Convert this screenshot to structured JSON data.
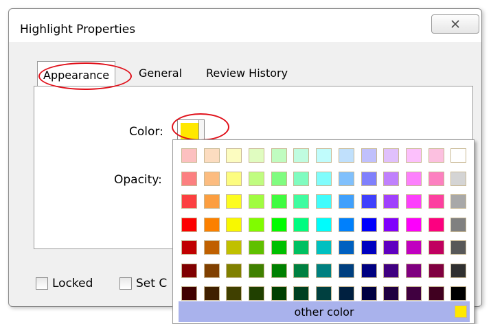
{
  "dialog": {
    "title": "Highlight Properties"
  },
  "tabs": [
    {
      "label": "Appearance"
    },
    {
      "label": "General"
    },
    {
      "label": "Review History"
    }
  ],
  "appearance": {
    "color_label": "Color:",
    "opacity_label": "Opacity:",
    "selected_color": "#ffe800"
  },
  "checkboxes": {
    "locked": "Locked",
    "set_current": "Set C"
  },
  "palette": {
    "other_color_label": "other color",
    "other_color_swatch": "#ffe800",
    "rows": [
      [
        "#fcc0c0",
        "#fcdcc0",
        "#fcfcc0",
        "#e0fcc0",
        "#c0fcc0",
        "#c0fce0",
        "#c0fcfc",
        "#c0e0fc",
        "#c0c0fc",
        "#e0c0fc",
        "#fcc0fc",
        "#fcc0e0",
        "#ffffff"
      ],
      [
        "#fc8080",
        "#fcbc80",
        "#fcfc80",
        "#c0fc80",
        "#80fc80",
        "#80fcc0",
        "#80fcfc",
        "#80c0fc",
        "#8080fc",
        "#c080fc",
        "#fc80fc",
        "#fc80c0",
        "#d4d4d4"
      ],
      [
        "#fc4040",
        "#fc9e40",
        "#fcfc20",
        "#a0fc40",
        "#40fc40",
        "#40fca0",
        "#40fcfc",
        "#40a0fc",
        "#4040fc",
        "#a040fc",
        "#fc40fc",
        "#fc40a0",
        "#a8a8a8"
      ],
      [
        "#fc0000",
        "#fc8000",
        "#f8f800",
        "#80fc00",
        "#00fc00",
        "#00fc80",
        "#00fcfc",
        "#0080fc",
        "#0000fc",
        "#8000fc",
        "#fc00fc",
        "#fc0080",
        "#808080"
      ],
      [
        "#c00000",
        "#c06000",
        "#c0c000",
        "#60c000",
        "#00c000",
        "#00c060",
        "#00c0c0",
        "#0060c0",
        "#0000c0",
        "#6000c0",
        "#c000c0",
        "#c00060",
        "#585858"
      ],
      [
        "#800000",
        "#804000",
        "#808000",
        "#408000",
        "#008000",
        "#008040",
        "#008080",
        "#004080",
        "#000080",
        "#400080",
        "#800080",
        "#800040",
        "#303030"
      ],
      [
        "#400000",
        "#402000",
        "#404000",
        "#204000",
        "#004000",
        "#004020",
        "#004040",
        "#002040",
        "#000040",
        "#200040",
        "#400040",
        "#400020",
        "#000000"
      ]
    ]
  }
}
